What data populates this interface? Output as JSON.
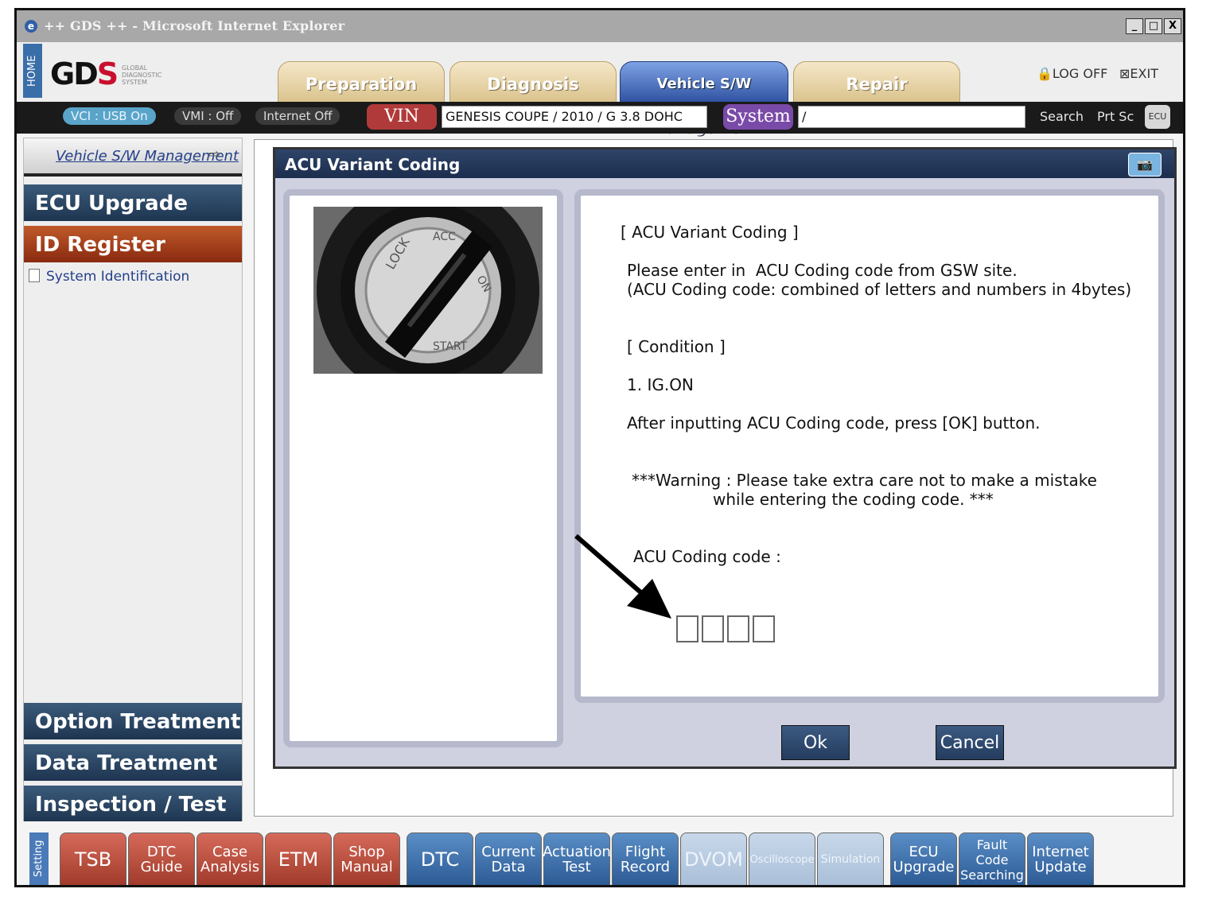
{
  "window": {
    "title": "++ GDS ++ - Microsoft Internet Explorer",
    "controls": [
      "_",
      "□",
      "X"
    ]
  },
  "header": {
    "home_label": "HOME",
    "logo": "GDS",
    "logo_sub": "GLOBAL DIAGNOSTIC SYSTEM",
    "tabs": [
      {
        "label": "Preparation",
        "active": false
      },
      {
        "label": "Diagnosis",
        "active": false
      },
      {
        "label": "Vehicle S/W Management",
        "active": true
      },
      {
        "label": "Repair",
        "active": false
      }
    ],
    "logoff_label": "LOG OFF",
    "exit_label": "EXIT"
  },
  "toolbar": {
    "vci_label": "VCI : USB On",
    "vmi_label": "VMI : Off",
    "internet_label": "Internet Off",
    "vin_label": "VIN",
    "vin_value": "GENESIS COUPE / 2010 / G 3.8 DOHC",
    "system_label": "System",
    "system_value": "/",
    "search_label": "Search",
    "prtsc_label": "Prt Sc",
    "ecu_icon": "ECU"
  },
  "sidebar": {
    "header": "Vehicle S/W Management",
    "menu_top": [
      {
        "label": "ECU Upgrade",
        "active": false
      },
      {
        "label": "ID Register",
        "active": true
      }
    ],
    "sub_item": "System Identification",
    "menu_bottom": [
      {
        "label": "Option Treatment"
      },
      {
        "label": "Data Treatment"
      },
      {
        "label": "Inspection / Test"
      }
    ]
  },
  "dialog": {
    "title": "ACU Variant Coding",
    "heading": "[ ACU Variant Coding ]",
    "instruction_1": "Please enter in  ACU Coding code from GSW site.",
    "instruction_2": "(ACU Coding code: combined of letters and numbers in 4bytes)",
    "condition_heading": "[ Condition ]",
    "condition_1": "1. IG.ON",
    "after_text": "After inputting ACU Coding code, press [OK] button.",
    "warning_1": "***Warning : Please take extra care not to make a mistake",
    "warning_2": "while entering the coding code. ***",
    "code_label": "ACU Coding code :",
    "code_boxes": [
      "",
      "",
      "",
      ""
    ],
    "ok_label": "Ok",
    "cancel_label": "Cancel"
  },
  "bottombar": {
    "setting_label": "Setting",
    "buttons": [
      {
        "label": "TSB",
        "style": "red"
      },
      {
        "label": "DTC Guide",
        "style": "red"
      },
      {
        "label": "Case Analysis",
        "style": "red"
      },
      {
        "label": "ETM",
        "style": "red"
      },
      {
        "label": "Shop Manual",
        "style": "red"
      },
      {
        "label": "DTC",
        "style": "blue"
      },
      {
        "label": "Current Data",
        "style": "blue"
      },
      {
        "label": "Actuation Test",
        "style": "blue"
      },
      {
        "label": "Flight Record",
        "style": "blue"
      },
      {
        "label": "DVOM",
        "style": "pale"
      },
      {
        "label": "Oscilloscope",
        "style": "pale"
      },
      {
        "label": "Simulation",
        "style": "pale"
      },
      {
        "label": "ECU Upgrade",
        "style": "blue"
      },
      {
        "label": "Fault Code Searching",
        "style": "blue"
      },
      {
        "label": "Internet Update",
        "style": "blue"
      }
    ]
  }
}
